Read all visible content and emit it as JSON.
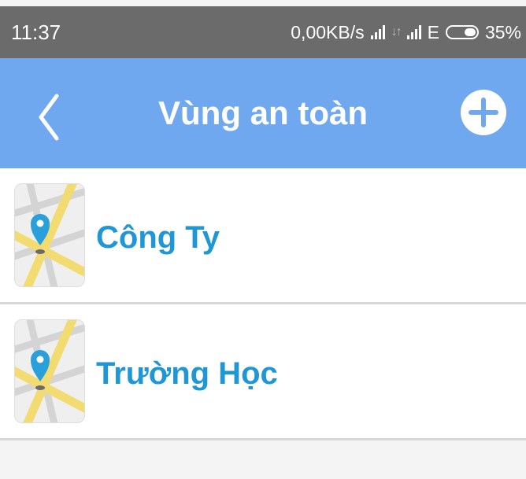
{
  "status_bar": {
    "time": "11:37",
    "network_speed": "0,00KB/s",
    "network_type": "E",
    "battery": "35%"
  },
  "header": {
    "title": "Vùng an toàn",
    "back_icon": "chevron-left-icon",
    "add_icon": "plus-circle-icon"
  },
  "zones": [
    {
      "label": "Công Ty",
      "icon": "map-pin-thumbnail"
    },
    {
      "label": "Trường Học",
      "icon": "map-pin-thumbnail"
    }
  ],
  "colors": {
    "header": "#6fa8ef",
    "status_bar": "#6b6b6b",
    "item_text": "#1f96d6",
    "pin": "#29a0dc"
  }
}
